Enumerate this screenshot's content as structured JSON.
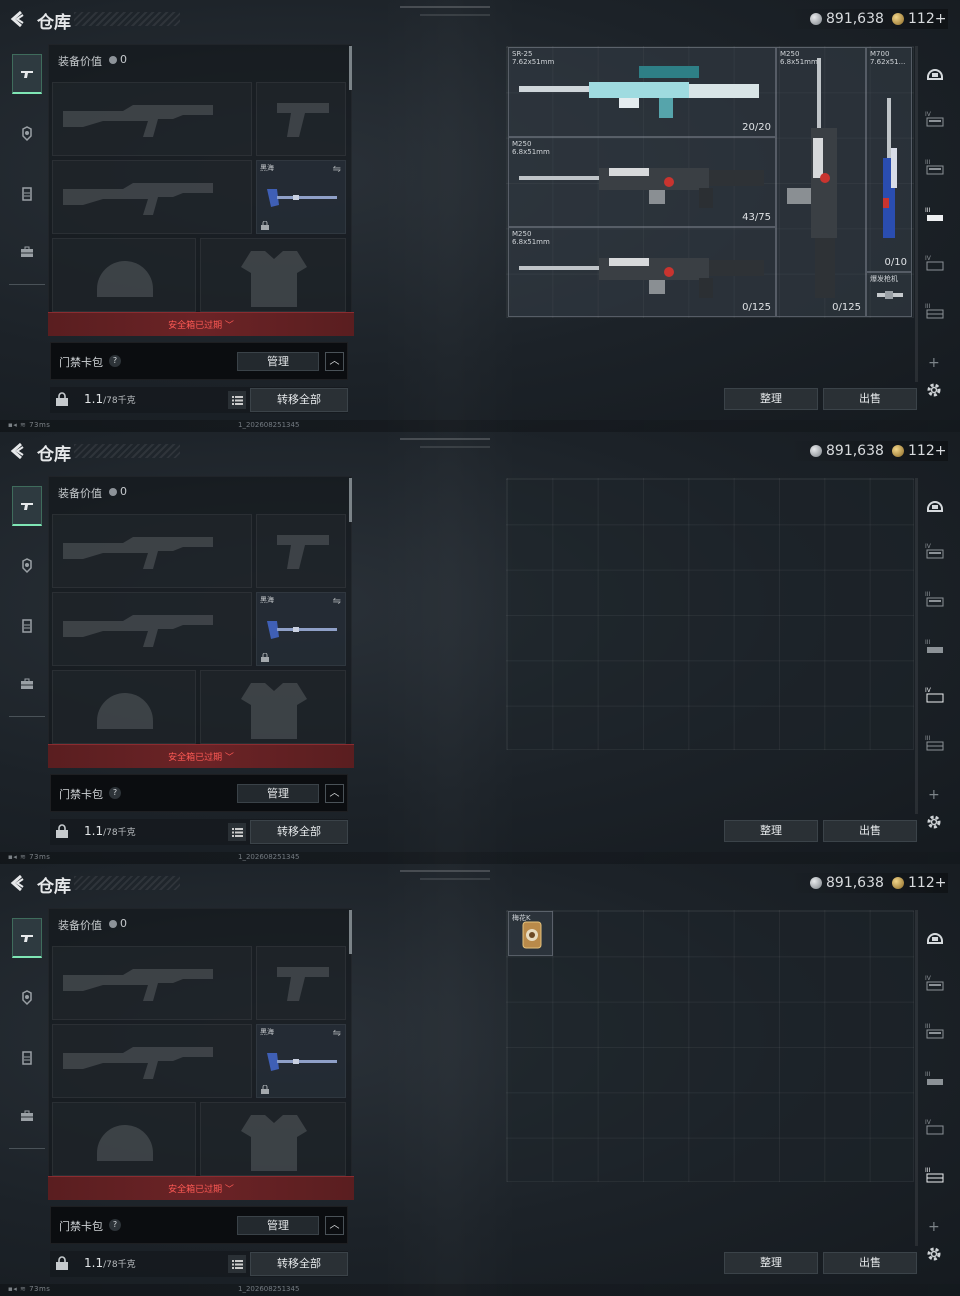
{
  "panels": [
    {
      "header": {
        "title": "仓库",
        "silver": "891,638",
        "gold": "112+"
      },
      "loadout": {
        "equip_label": "装备价值",
        "equip_value": "0",
        "slot_tag": "黑海",
        "expired": "安全箱已过期 ﹀",
        "card_label": "门禁卡包",
        "help": "?",
        "manage": "管理",
        "chev": "^",
        "weight_value": "1.1",
        "weight_unit": "/78千克",
        "transfer": "转移全部"
      },
      "status": {
        "left": "73ms",
        "build": "1_202608251345"
      },
      "grid": {
        "items": [
          {
            "name": "SR-25\n7.62x51mm",
            "count": "20/20"
          },
          {
            "name": "M250\n6.8x51mm",
            "count": "43/75"
          },
          {
            "name": "M250\n6.8x51mm",
            "count": "0/125"
          },
          {
            "name": "M250\n6.8x51mm",
            "count": "0/125"
          },
          {
            "name": "M700\n7.62x51...",
            "count": "0/10"
          },
          {
            "name": "爆发枪机",
            "count": ""
          }
        ]
      },
      "actions": {
        "sort": "整理",
        "sell": "出售"
      }
    },
    {
      "header": {
        "title": "仓库",
        "silver": "891,638",
        "gold": "112+"
      },
      "loadout": {
        "equip_label": "装备价值",
        "equip_value": "0",
        "slot_tag": "黑海",
        "expired": "安全箱已过期 ﹀",
        "card_label": "门禁卡包",
        "help": "?",
        "manage": "管理",
        "chev": "^",
        "weight_value": "1.1",
        "weight_unit": "/78千克",
        "transfer": "转移全部"
      },
      "status": {
        "left": "73ms",
        "build": "1_202608251345"
      },
      "grid": {
        "items": []
      },
      "actions": {
        "sort": "整理",
        "sell": "出售"
      }
    },
    {
      "header": {
        "title": "仓库",
        "silver": "891,638",
        "gold": "112+"
      },
      "loadout": {
        "equip_label": "装备价值",
        "equip_value": "0",
        "slot_tag": "黑海",
        "expired": "安全箱已过期 ﹀",
        "card_label": "门禁卡包",
        "help": "?",
        "manage": "管理",
        "chev": "^",
        "weight_value": "1.1",
        "weight_unit": "/78千克",
        "transfer": "转移全部"
      },
      "status": {
        "left": "73ms",
        "build": "1_202608251345"
      },
      "grid": {
        "items": [
          {
            "name": "梅花K",
            "count": ""
          }
        ]
      },
      "actions": {
        "sort": "整理",
        "sell": "出售"
      }
    }
  ],
  "icons": {
    "back": "back-arrow-icon",
    "left_tabs": [
      "gun-icon",
      "armor-icon",
      "vest-icon",
      "briefcase-icon"
    ],
    "right_tabs": [
      "helmet-icon",
      "rack-iv-icon",
      "rack-iii-icon",
      "rack-ii-icon",
      "rack-iv-b-icon",
      "rack-iii-b-icon"
    ],
    "settings": "gear-icon"
  },
  "colors": {
    "accent_green": "#7fe6b5",
    "expired_red": "#ff5a55",
    "expired_bar": "#6b2326"
  }
}
